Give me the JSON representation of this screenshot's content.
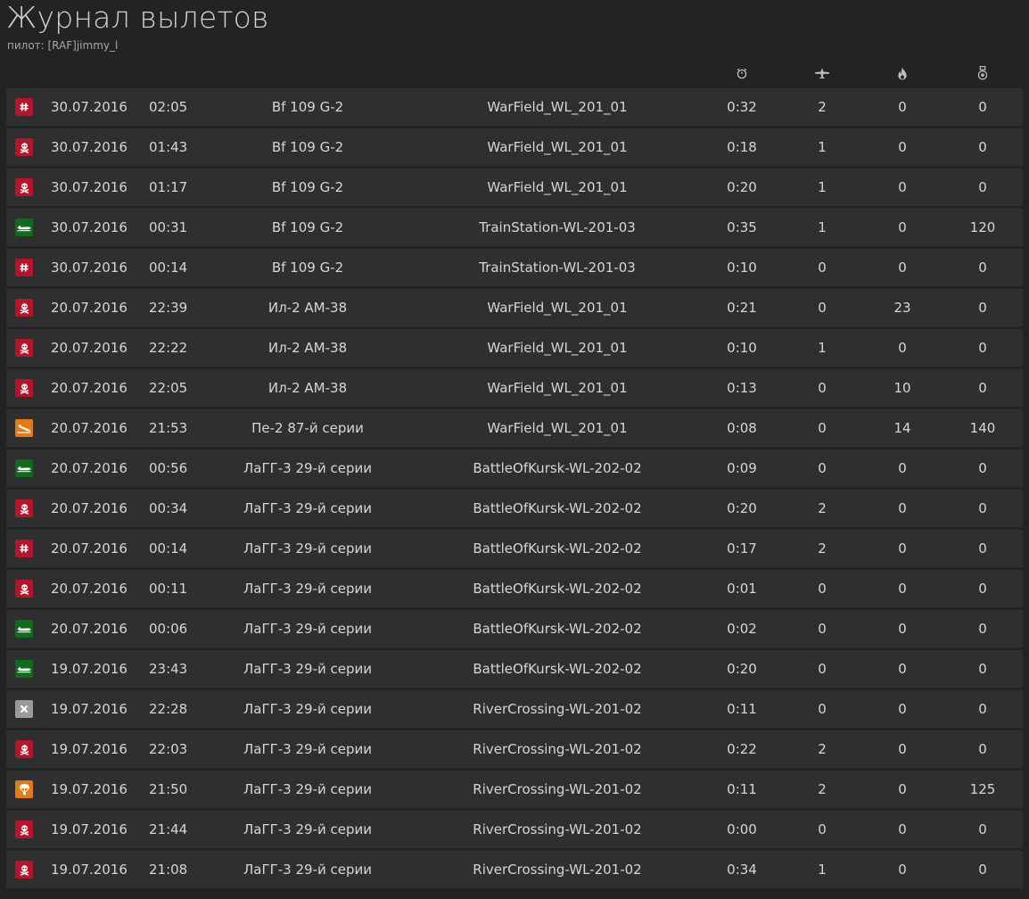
{
  "title": "Журнал вылетов",
  "pilot_label": "пилот: [RAF]jimmy_l",
  "header_icons": [
    "stopwatch-icon",
    "plane-icon",
    "fire-icon",
    "medal-icon"
  ],
  "status_colors": {
    "red": "#b5152b",
    "green": "#0f6b1c",
    "orange": "#e07b18",
    "gray": "#9a9a9a"
  },
  "sorties": [
    {
      "status": "hash",
      "date": "30.07.2016",
      "time": "02:05",
      "aircraft": "Bf 109 G-2",
      "mission": "WarField_WL_201_01",
      "duration": "0:32",
      "kills_air": "2",
      "kills_ground": "0",
      "score": "0"
    },
    {
      "status": "skull",
      "date": "30.07.2016",
      "time": "01:43",
      "aircraft": "Bf 109 G-2",
      "mission": "WarField_WL_201_01",
      "duration": "0:18",
      "kills_air": "1",
      "kills_ground": "0",
      "score": "0"
    },
    {
      "status": "skull",
      "date": "30.07.2016",
      "time": "01:17",
      "aircraft": "Bf 109 G-2",
      "mission": "WarField_WL_201_01",
      "duration": "0:20",
      "kills_air": "1",
      "kills_ground": "0",
      "score": "0"
    },
    {
      "status": "landed",
      "date": "30.07.2016",
      "time": "00:31",
      "aircraft": "Bf 109 G-2",
      "mission": "TrainStation-WL-201-03",
      "duration": "0:35",
      "kills_air": "1",
      "kills_ground": "0",
      "score": "120"
    },
    {
      "status": "hash",
      "date": "30.07.2016",
      "time": "00:14",
      "aircraft": "Bf 109 G-2",
      "mission": "TrainStation-WL-201-03",
      "duration": "0:10",
      "kills_air": "0",
      "kills_ground": "0",
      "score": "0"
    },
    {
      "status": "skull",
      "date": "20.07.2016",
      "time": "22:39",
      "aircraft": "Ил-2 АМ-38",
      "mission": "WarField_WL_201_01",
      "duration": "0:21",
      "kills_air": "0",
      "kills_ground": "23",
      "score": "0"
    },
    {
      "status": "skull",
      "date": "20.07.2016",
      "time": "22:22",
      "aircraft": "Ил-2 АМ-38",
      "mission": "WarField_WL_201_01",
      "duration": "0:10",
      "kills_air": "1",
      "kills_ground": "0",
      "score": "0"
    },
    {
      "status": "skull",
      "date": "20.07.2016",
      "time": "22:05",
      "aircraft": "Ил-2 АМ-38",
      "mission": "WarField_WL_201_01",
      "duration": "0:13",
      "kills_air": "0",
      "kills_ground": "10",
      "score": "0"
    },
    {
      "status": "crashed",
      "date": "20.07.2016",
      "time": "21:53",
      "aircraft": "Пе-2 87-й серии",
      "mission": "WarField_WL_201_01",
      "duration": "0:08",
      "kills_air": "0",
      "kills_ground": "14",
      "score": "140"
    },
    {
      "status": "landed",
      "date": "20.07.2016",
      "time": "00:56",
      "aircraft": "ЛаГГ-3 29-й серии",
      "mission": "BattleOfKursk-WL-202-02",
      "duration": "0:09",
      "kills_air": "0",
      "kills_ground": "0",
      "score": "0"
    },
    {
      "status": "skull",
      "date": "20.07.2016",
      "time": "00:34",
      "aircraft": "ЛаГГ-3 29-й серии",
      "mission": "BattleOfKursk-WL-202-02",
      "duration": "0:20",
      "kills_air": "2",
      "kills_ground": "0",
      "score": "0"
    },
    {
      "status": "hash",
      "date": "20.07.2016",
      "time": "00:14",
      "aircraft": "ЛаГГ-3 29-й серии",
      "mission": "BattleOfKursk-WL-202-02",
      "duration": "0:17",
      "kills_air": "2",
      "kills_ground": "0",
      "score": "0"
    },
    {
      "status": "skull",
      "date": "20.07.2016",
      "time": "00:11",
      "aircraft": "ЛаГГ-3 29-й серии",
      "mission": "BattleOfKursk-WL-202-02",
      "duration": "0:01",
      "kills_air": "0",
      "kills_ground": "0",
      "score": "0"
    },
    {
      "status": "landed",
      "date": "20.07.2016",
      "time": "00:06",
      "aircraft": "ЛаГГ-3 29-й серии",
      "mission": "BattleOfKursk-WL-202-02",
      "duration": "0:02",
      "kills_air": "0",
      "kills_ground": "0",
      "score": "0"
    },
    {
      "status": "landed",
      "date": "19.07.2016",
      "time": "23:43",
      "aircraft": "ЛаГГ-3 29-й серии",
      "mission": "BattleOfKursk-WL-202-02",
      "duration": "0:20",
      "kills_air": "0",
      "kills_ground": "0",
      "score": "0"
    },
    {
      "status": "disconnect",
      "date": "19.07.2016",
      "time": "22:28",
      "aircraft": "ЛаГГ-3 29-й серии",
      "mission": "RiverCrossing-WL-201-02",
      "duration": "0:11",
      "kills_air": "0",
      "kills_ground": "0",
      "score": "0"
    },
    {
      "status": "skull",
      "date": "19.07.2016",
      "time": "22:03",
      "aircraft": "ЛаГГ-3 29-й серии",
      "mission": "RiverCrossing-WL-201-02",
      "duration": "0:22",
      "kills_air": "2",
      "kills_ground": "0",
      "score": "0"
    },
    {
      "status": "bailout",
      "date": "19.07.2016",
      "time": "21:50",
      "aircraft": "ЛаГГ-3 29-й серии",
      "mission": "RiverCrossing-WL-201-02",
      "duration": "0:11",
      "kills_air": "2",
      "kills_ground": "0",
      "score": "125"
    },
    {
      "status": "skull",
      "date": "19.07.2016",
      "time": "21:44",
      "aircraft": "ЛаГГ-3 29-й серии",
      "mission": "RiverCrossing-WL-201-02",
      "duration": "0:00",
      "kills_air": "0",
      "kills_ground": "0",
      "score": "0"
    },
    {
      "status": "skull",
      "date": "19.07.2016",
      "time": "21:08",
      "aircraft": "ЛаГГ-3 29-й серии",
      "mission": "RiverCrossing-WL-201-02",
      "duration": "0:34",
      "kills_air": "1",
      "kills_ground": "0",
      "score": "0"
    }
  ]
}
